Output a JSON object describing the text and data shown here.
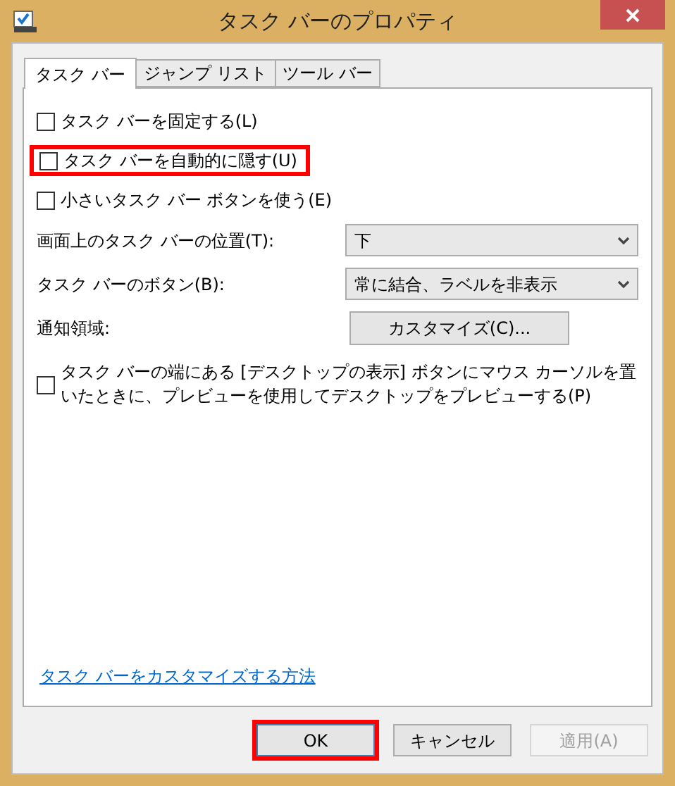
{
  "window": {
    "title": "タスク バーのプロパティ"
  },
  "tabs": [
    {
      "label": "タスク バー",
      "selected": true
    },
    {
      "label": "ジャンプ リスト",
      "selected": false
    },
    {
      "label": "ツール バー",
      "selected": false
    }
  ],
  "options": [
    {
      "label": "タスク バーを固定する(L)",
      "checked": false,
      "highlighted": false
    },
    {
      "label": "タスク バーを自動的に隠す(U)",
      "checked": false,
      "highlighted": true
    },
    {
      "label": "小さいタスク バー ボタンを使う(E)",
      "checked": false,
      "highlighted": false
    }
  ],
  "settings": [
    {
      "kind": "dropdown",
      "label": "画面上のタスク バーの位置(T):",
      "value": "下"
    },
    {
      "kind": "dropdown",
      "label": "タスク バーのボタン(B):",
      "value": "常に結合、ラベルを非表示"
    },
    {
      "kind": "button",
      "label": "通知領域:",
      "value": "カスタマイズ(C)..."
    }
  ],
  "peek_option": {
    "label": "タスク バーの端にある [デスクトップの表示] ボタンにマウス カーソルを置いたときに、プレビューを使用してデスクトップをプレビューする(P)",
    "checked": false
  },
  "help_link": "タスク バーをカスタマイズする方法",
  "buttons": [
    {
      "label": "OK",
      "disabled": false,
      "highlighted": true
    },
    {
      "label": "キャンセル",
      "disabled": false,
      "highlighted": false
    },
    {
      "label": "適用(A)",
      "disabled": true,
      "highlighted": false
    }
  ]
}
